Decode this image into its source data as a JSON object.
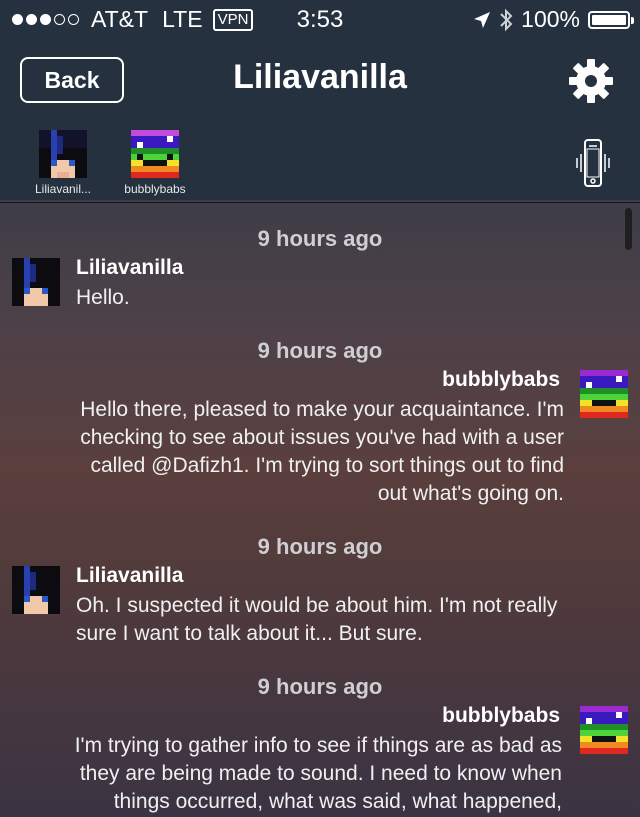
{
  "status_bar": {
    "carrier": "AT&T",
    "network": "LTE",
    "vpn": "VPN",
    "time": "3:53",
    "battery": "100%",
    "signal_bars_filled": 3,
    "signal_bars_total": 5
  },
  "nav": {
    "back_label": "Back",
    "title": "Liliavanilla"
  },
  "participants": [
    {
      "name": "Liliavanil..."
    },
    {
      "name": "bubblybabs"
    }
  ],
  "messages": [
    {
      "timestamp": "9 hours ago",
      "sender": "Liliavanilla",
      "side": "left",
      "lines": [
        "Hello."
      ]
    },
    {
      "timestamp": "9 hours ago",
      "sender": "bubblybabs",
      "side": "right",
      "lines": [
        "Hello there, pleased to make your acquaintance.  I'm",
        "checking to see about issues you've had with a user",
        "called @Dafizh1.  I'm trying to sort things out to find",
        "out what's going on."
      ]
    },
    {
      "timestamp": "9 hours ago",
      "sender": "Liliavanilla",
      "side": "left",
      "lines": [
        "Oh. I suspected it would be about him. I'm not really",
        "sure I want to  talk about it... But sure."
      ]
    },
    {
      "timestamp": "9 hours ago",
      "sender": "bubblybabs",
      "side": "right",
      "lines": [
        "I'm trying to gather info to see if things are as bad as",
        "they are being made to sound.  I need to know when",
        "things occurred, what was said, what happened,"
      ]
    }
  ],
  "colors": {
    "header_bg": "#263140",
    "text": "#ffffff",
    "timestamp": "#cfcfd3"
  }
}
